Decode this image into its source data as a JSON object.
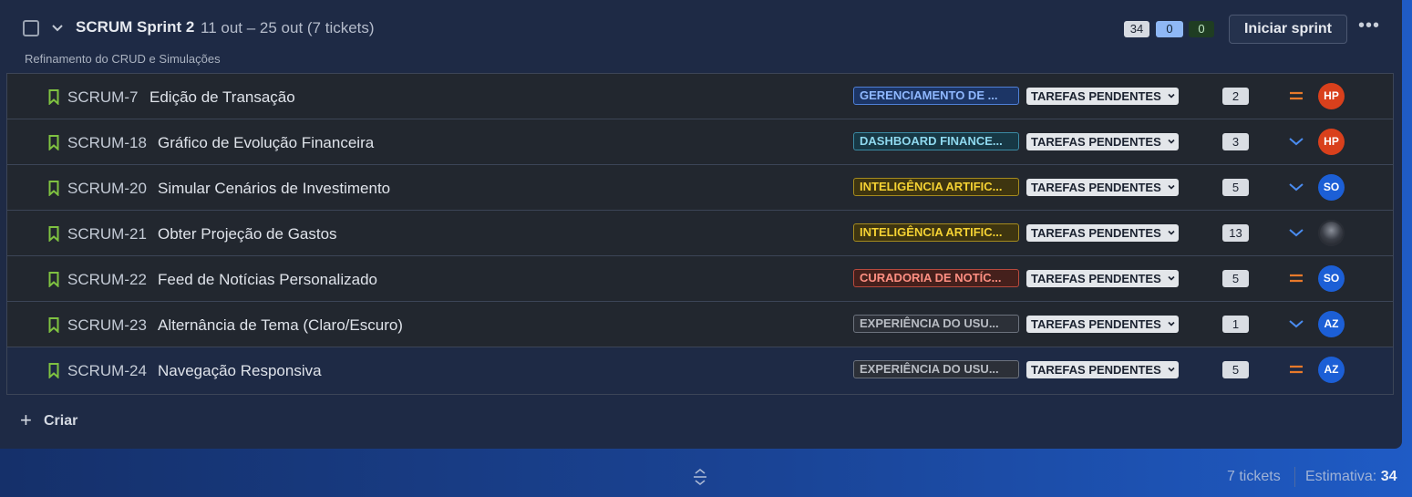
{
  "sprint": {
    "title": "SCRUM Sprint 2",
    "dates": "11 out – 25 out (7 tickets)",
    "goal": "Refinamento do CRUD e Simulações",
    "counts": [
      "34",
      "0",
      "0"
    ],
    "start_label": "Iniciar sprint",
    "more_label": "•••"
  },
  "issues": [
    {
      "key": "SCRUM-7",
      "summary": "Edição de Transação",
      "epic": "GERENCIAMENTO DE ...",
      "status": "TAREFAS PENDENTES",
      "points": "2",
      "priority": "medium",
      "assignee": "HP"
    },
    {
      "key": "SCRUM-18",
      "summary": "Gráfico de Evolução Financeira",
      "epic": "DASHBOARD FINANCE...",
      "status": "TAREFAS PENDENTES",
      "points": "3",
      "priority": "low",
      "assignee": "HP"
    },
    {
      "key": "SCRUM-20",
      "summary": "Simular Cenários de Investimento",
      "epic": "INTELIGÊNCIA ARTIFIC...",
      "status": "TAREFAS PENDENTES",
      "points": "5",
      "priority": "low",
      "assignee": "SO"
    },
    {
      "key": "SCRUM-21",
      "summary": "Obter Projeção de Gastos",
      "epic": "INTELIGÊNCIA ARTIFIC...",
      "status": "TAREFAS PENDENTES",
      "points": "13",
      "priority": "low",
      "assignee": ""
    },
    {
      "key": "SCRUM-22",
      "summary": "Feed de Notícias Personalizado",
      "epic": "CURADORIA DE NOTÍC...",
      "status": "TAREFAS PENDENTES",
      "points": "5",
      "priority": "medium",
      "assignee": "SO"
    },
    {
      "key": "SCRUM-23",
      "summary": "Alternância de Tema (Claro/Escuro)",
      "epic": "EXPERIÊNCIA DO USU...",
      "status": "TAREFAS PENDENTES",
      "points": "1",
      "priority": "low",
      "assignee": "AZ"
    },
    {
      "key": "SCRUM-24",
      "summary": "Navegação Responsiva",
      "epic": "EXPERIÊNCIA DO USU...",
      "status": "TAREFAS PENDENTES",
      "points": "5",
      "priority": "medium",
      "assignee": "AZ"
    }
  ],
  "epic_colors": {
    "GERENCIAMENTO DE ...": {
      "fg": "#8fb8ff",
      "bg": "#1c3565",
      "border": "#4f7fd6"
    },
    "DASHBOARD FINANCE...": {
      "fg": "#8fd8ee",
      "bg": "#173845",
      "border": "#3b8aa3"
    },
    "INTELIGÊNCIA ARTIFIC...": {
      "fg": "#f5d233",
      "bg": "#3e3510",
      "border": "#a58b1e"
    },
    "CURADORIA DE NOTÍC...": {
      "fg": "#ff8f82",
      "bg": "#45201c",
      "border": "#b8493d"
    },
    "EXPERIÊNCIA DO USU...": {
      "fg": "#b8bcc3",
      "bg": "#2c3038",
      "border": "#6c727d"
    }
  },
  "avatar_colors": {
    "HP": "#d9401c",
    "SO": "#1c5fd6",
    "AZ": "#1c5fd6"
  },
  "priority_colors": {
    "medium": "#e8792a",
    "low": "#4a8cf0"
  },
  "create_label": "Criar",
  "footer": {
    "tickets": "7 tickets",
    "estimate_label": "Estimativa:",
    "estimate_value": "34"
  }
}
